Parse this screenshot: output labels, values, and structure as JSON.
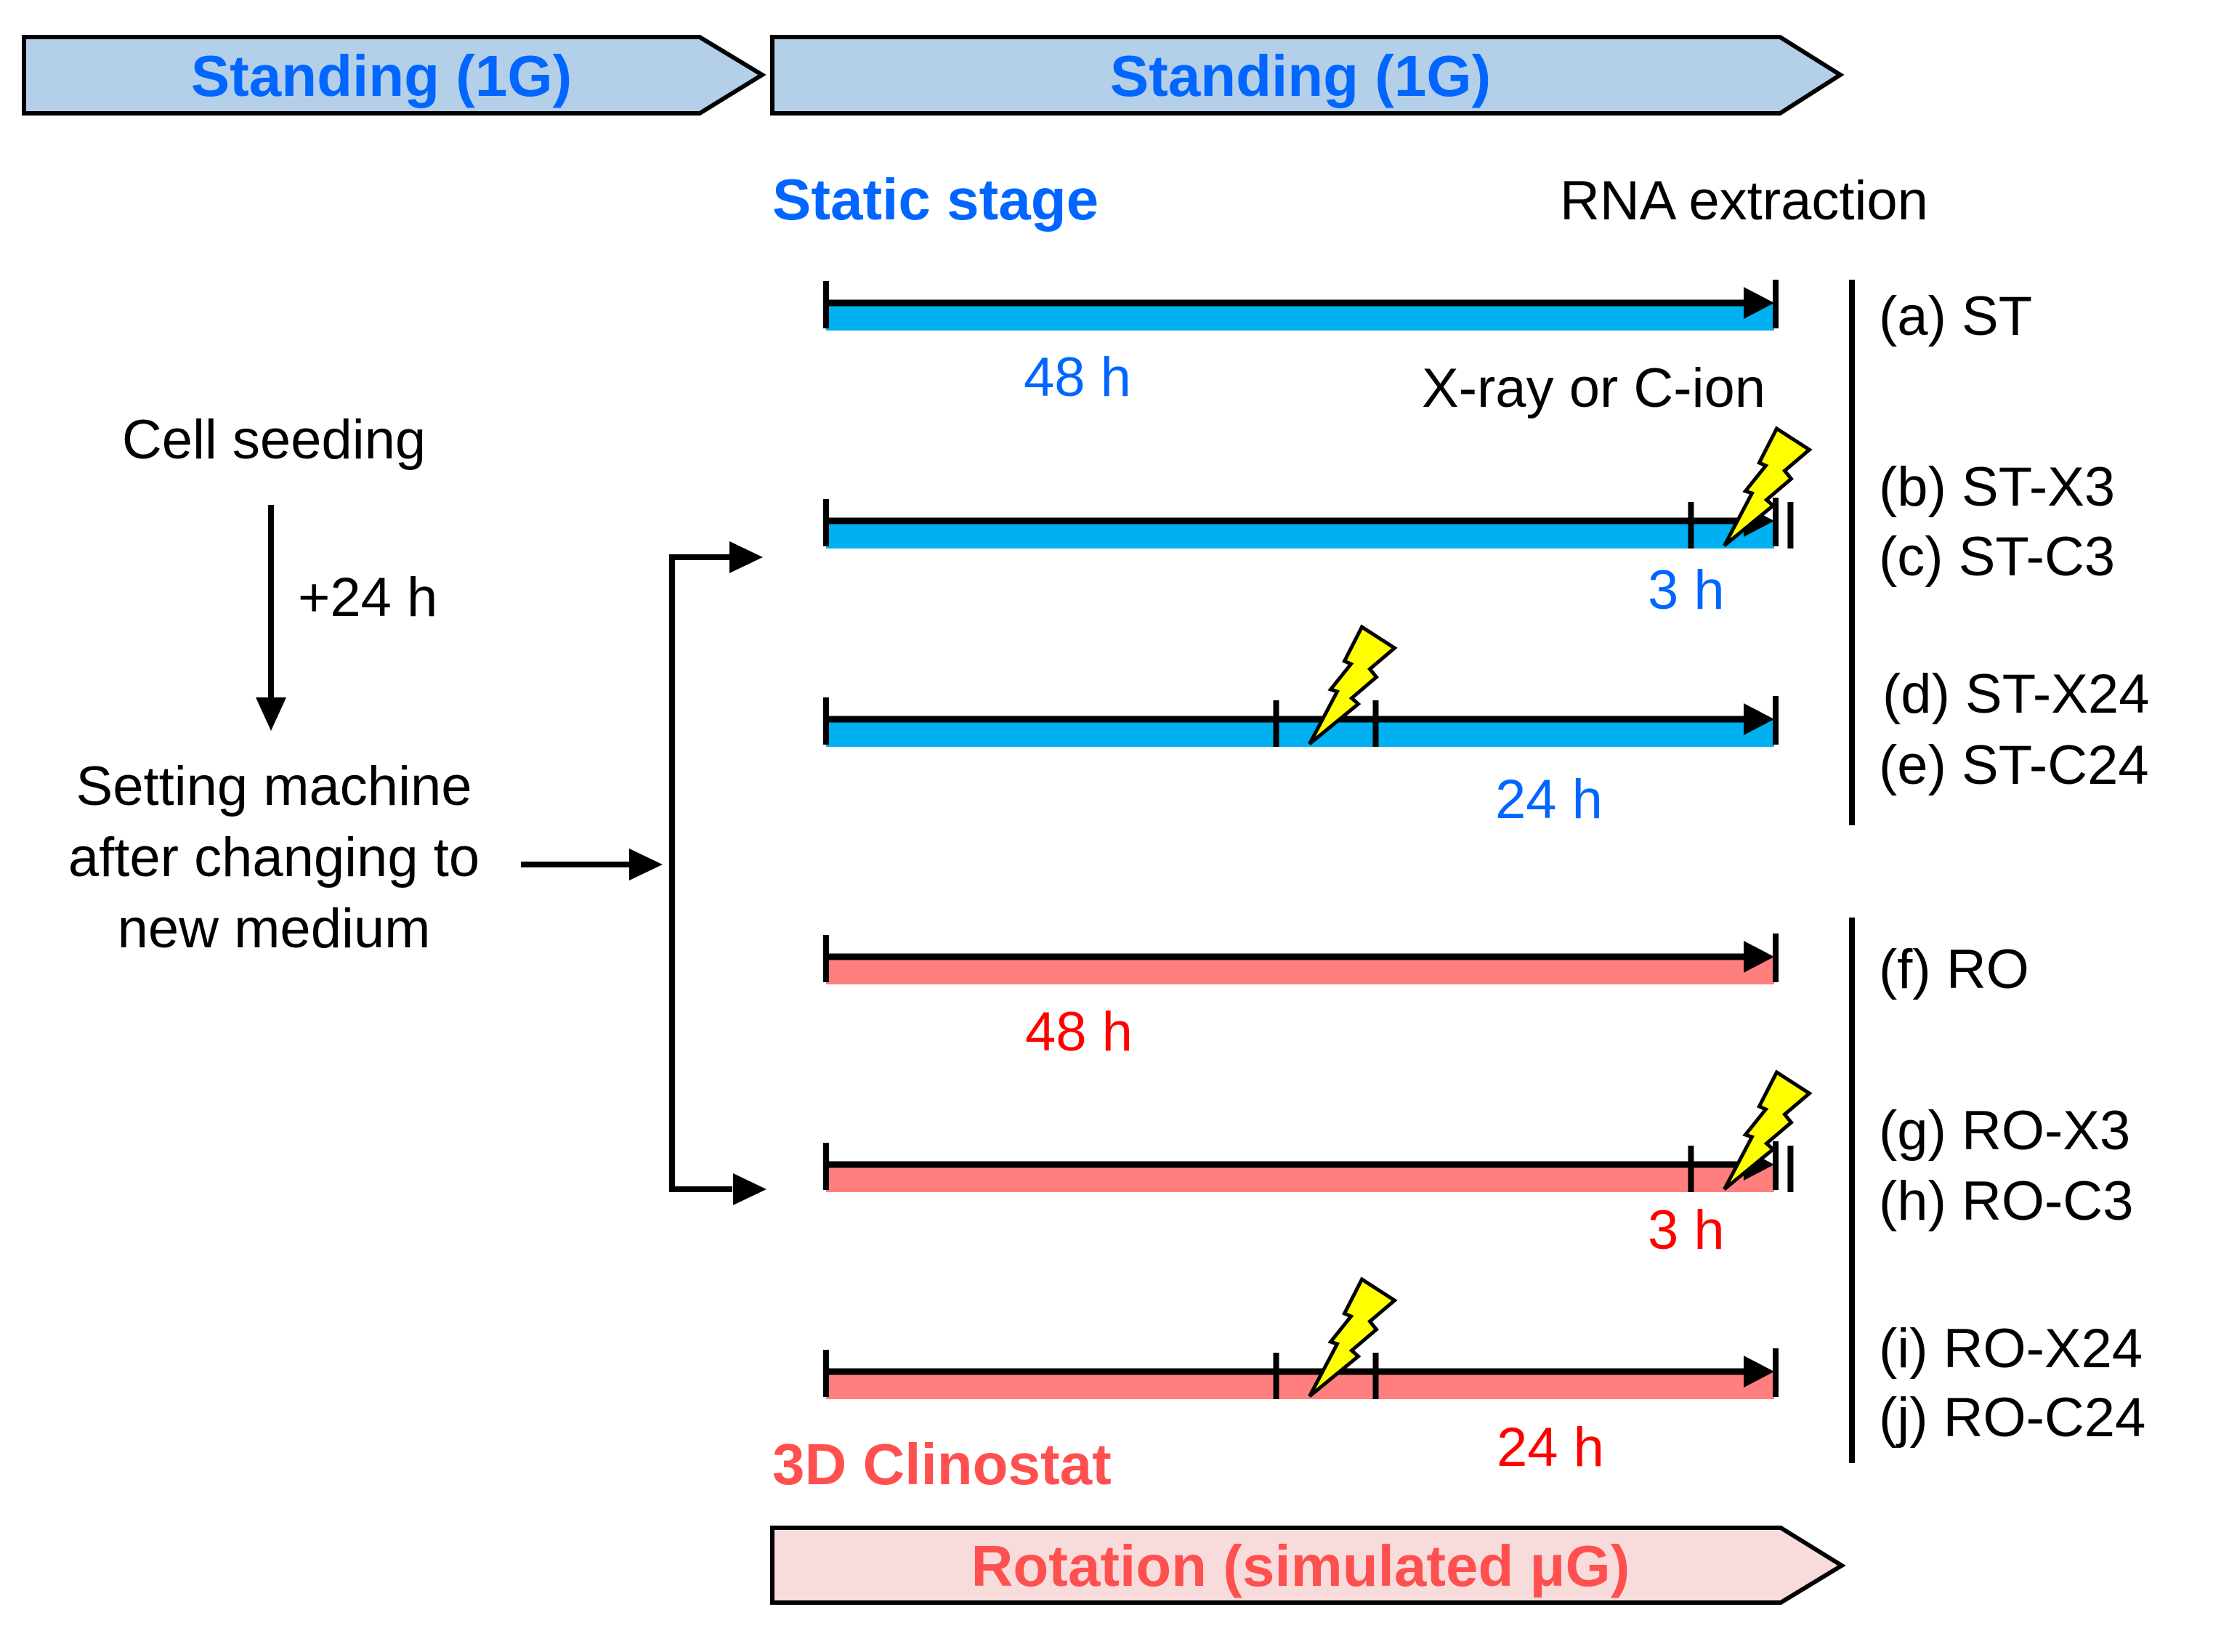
{
  "colors": {
    "standing_banner_fill": "#B4CFE8",
    "standing_text": "#0066FF",
    "rotation_banner_fill": "#F8DCDC",
    "rotation_text": "#FF5050",
    "static_bar": "#00B0F0",
    "rotation_bar": "#FF7F7F",
    "static_duration_text": "#0066FF",
    "rotation_duration_text": "#FF0000",
    "bolt_fill": "#FFFF00"
  },
  "banners": {
    "pre_standing": {
      "label": "Standing (1G)"
    },
    "standing": {
      "label": "Standing (1G)"
    },
    "rotation": {
      "label": "Rotation (simulated μG)"
    }
  },
  "headings": {
    "static_stage": "Static stage",
    "rna_extraction": "RNA extraction",
    "clinostat": "3D Clinostat",
    "irradiation": "X-ray or C-ion"
  },
  "left_flow": {
    "cell_seeding": "Cell seeding",
    "interval": "+24 h",
    "setting_lines": [
      "Setting machine",
      "after changing to",
      "new medium"
    ]
  },
  "timeline": {
    "total_hours": 48,
    "rows": [
      {
        "id": "st",
        "condition": "static",
        "irradiated": false,
        "duration_label": "48 h",
        "hours_before_extraction": null
      },
      {
        "id": "st-3",
        "condition": "static",
        "irradiated": true,
        "duration_label": "3 h",
        "hours_before_extraction": 3
      },
      {
        "id": "st-24",
        "condition": "static",
        "irradiated": true,
        "duration_label": "24 h",
        "hours_before_extraction": 24
      },
      {
        "id": "ro",
        "condition": "rotation",
        "irradiated": false,
        "duration_label": "48 h",
        "hours_before_extraction": null
      },
      {
        "id": "ro-3",
        "condition": "rotation",
        "irradiated": true,
        "duration_label": "3 h",
        "hours_before_extraction": 3
      },
      {
        "id": "ro-24",
        "condition": "rotation",
        "irradiated": true,
        "duration_label": "24 h",
        "hours_before_extraction": 24
      }
    ]
  },
  "groups": {
    "static": [
      "(a) ST",
      "(b) ST-X3",
      "(c) ST-C3",
      "(d) ST-X24",
      "(e) ST-C24"
    ],
    "rotation": [
      "(f) RO",
      "(g) RO-X3",
      "(h) RO-C3",
      "(i) RO-X24",
      "(j) RO-C24"
    ]
  }
}
